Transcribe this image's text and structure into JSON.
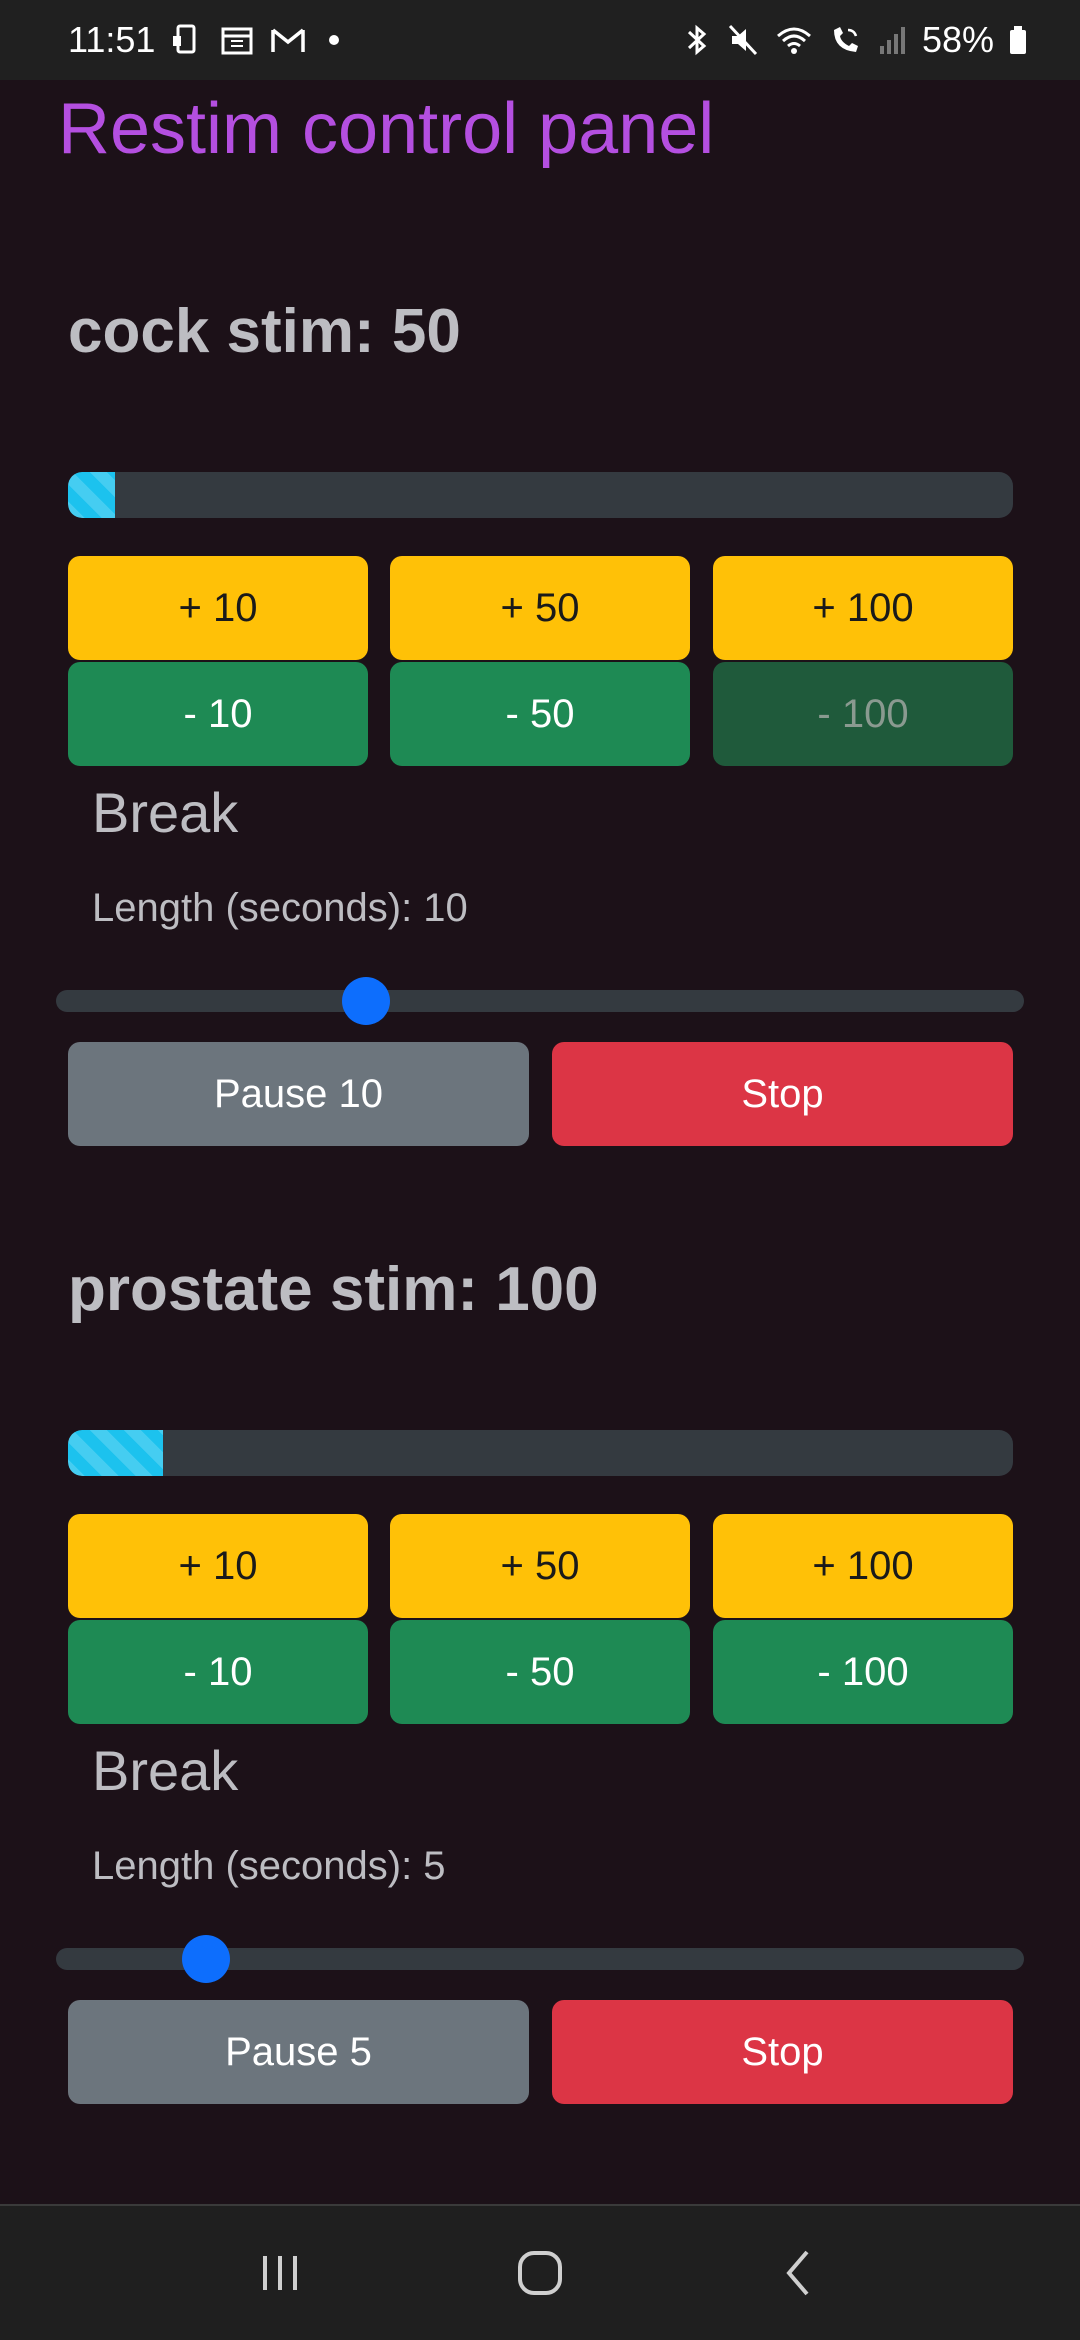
{
  "status_bar": {
    "time": "11:51",
    "battery": "58%",
    "icons_left": [
      "phone-icon",
      "calendar-icon",
      "gmail-icon",
      "dot-icon"
    ],
    "icons_right": [
      "bluetooth-icon",
      "mute-icon",
      "wifi-icon",
      "wifi-call-icon",
      "signal-icon",
      "battery-icon"
    ]
  },
  "app": {
    "title": "Restim control panel"
  },
  "channels": [
    {
      "title": "cock stim: 50",
      "progress": 0.05,
      "plus_buttons": [
        "+ 10",
        "+ 50",
        "+ 100"
      ],
      "minus_buttons": [
        "- 10",
        "- 50",
        "- 100"
      ],
      "minus_disabled": [
        false,
        false,
        true
      ],
      "break_label": "Break",
      "length_label": "Length (seconds): 10",
      "slider_value": 0.32,
      "pause_label": "Pause 10",
      "stop_label": "Stop"
    },
    {
      "title": "prostate stim: 100",
      "progress": 0.1,
      "plus_buttons": [
        "+ 10",
        "+ 50",
        "+ 100"
      ],
      "minus_buttons": [
        "- 10",
        "- 50",
        "- 100"
      ],
      "minus_disabled": [
        false,
        false,
        false
      ],
      "break_label": "Break",
      "length_label": "Length (seconds): 5",
      "slider_value": 0.155,
      "pause_label": "Pause 5",
      "stop_label": "Stop"
    }
  ],
  "nav_bar": {
    "icons": [
      "recent-apps-icon",
      "home-icon",
      "back-icon"
    ]
  }
}
